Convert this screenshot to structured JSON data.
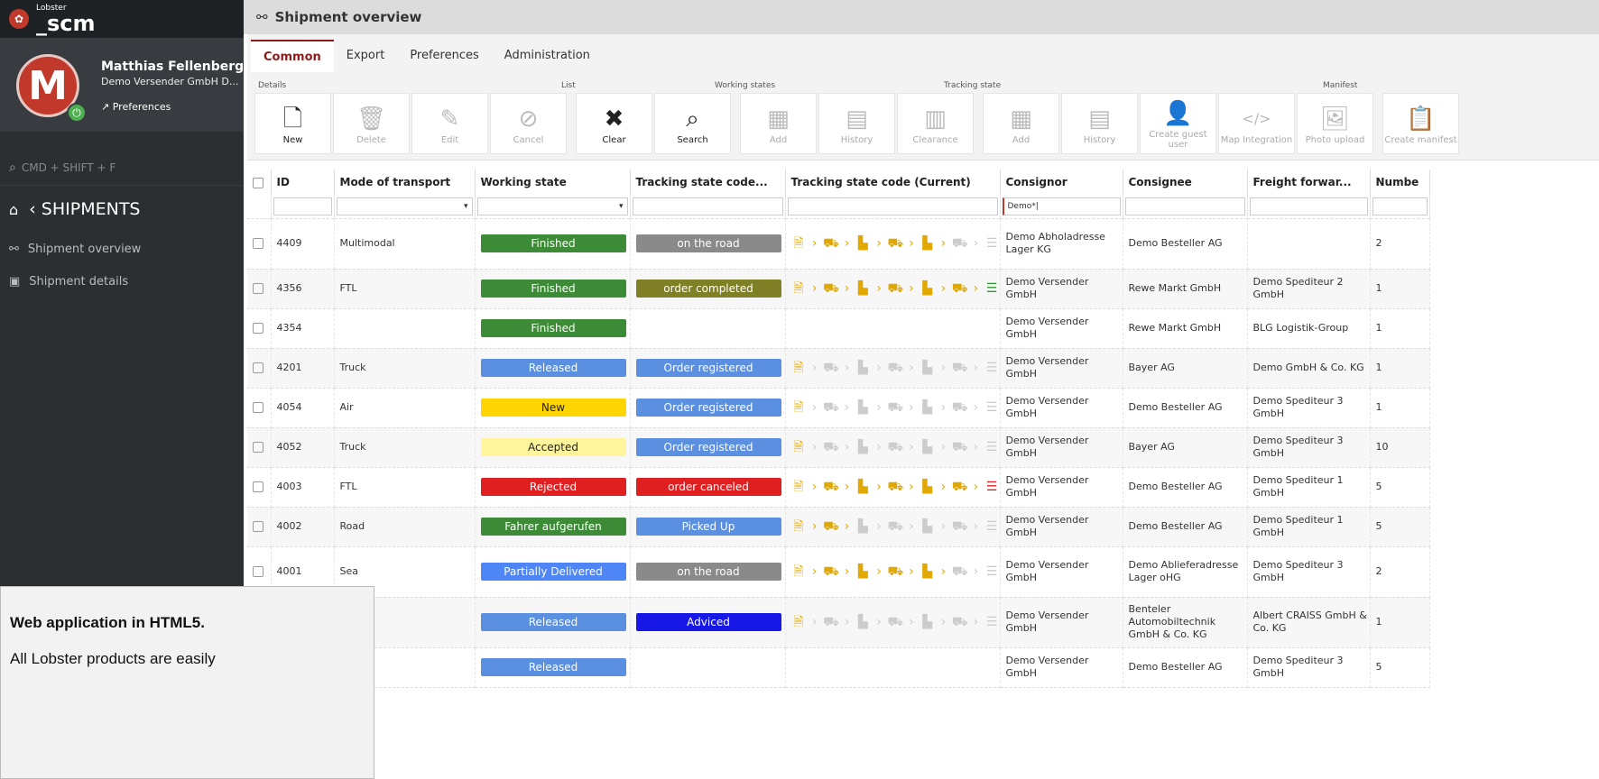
{
  "app": {
    "logo_small": "Lobster",
    "logo_big": "_scm"
  },
  "user": {
    "name": "Matthias Fellenberg",
    "company": "Demo Versender GmbH D...",
    "avatar_letter": "M",
    "preferences_label": "Preferences"
  },
  "sidebar": {
    "search_placeholder": "CMD + SHIFT + F",
    "section_title": "SHIPMENTS",
    "items": [
      {
        "label": "Shipment overview"
      },
      {
        "label": "Shipment details"
      }
    ]
  },
  "page": {
    "title": "Shipment overview"
  },
  "tabs": [
    "Common",
    "Export",
    "Preferences",
    "Administration"
  ],
  "groups": {
    "details": "Details",
    "list": "List",
    "working": "Working states",
    "tracking": "Tracking state",
    "manifest": "Manifest"
  },
  "toolbar": [
    {
      "label": "New",
      "icon": "new-document-icon",
      "glyph": "🗋",
      "disabled": false
    },
    {
      "label": "Delete",
      "icon": "trash-icon",
      "glyph": "🗑",
      "disabled": true
    },
    {
      "label": "Edit",
      "icon": "edit-icon",
      "glyph": "✎",
      "disabled": true
    },
    {
      "label": "Cancel",
      "icon": "cancel-icon",
      "glyph": "⊘",
      "disabled": true
    },
    {
      "label": "Clear",
      "icon": "clear-icon",
      "glyph": "✖",
      "disabled": false
    },
    {
      "label": "Search",
      "icon": "binoculars-icon",
      "glyph": "⌕",
      "disabled": false
    },
    {
      "label": "Add",
      "icon": "add-state-icon",
      "glyph": "▦",
      "disabled": true
    },
    {
      "label": "History",
      "icon": "history-icon",
      "glyph": "▤",
      "disabled": true
    },
    {
      "label": "Clearance",
      "icon": "clearance-icon",
      "glyph": "▥",
      "disabled": true
    },
    {
      "label": "Add",
      "icon": "add-tracking-icon",
      "glyph": "▦",
      "disabled": true
    },
    {
      "label": "History",
      "icon": "tracking-history-icon",
      "glyph": "▤",
      "disabled": true
    },
    {
      "label": "Create guest user",
      "icon": "guest-user-icon",
      "glyph": "👤",
      "disabled": true
    },
    {
      "label": "Map Integration",
      "icon": "code-icon",
      "glyph": "</>",
      "disabled": true
    },
    {
      "label": "Photo upload",
      "icon": "photo-icon",
      "glyph": "🖼",
      "disabled": true
    },
    {
      "label": "Create manifest",
      "icon": "manifest-icon",
      "glyph": "📋",
      "disabled": true
    }
  ],
  "columns": [
    "ID",
    "Mode of transport",
    "Working state",
    "Tracking state code...",
    "Tracking state code (Current)",
    "Consignor",
    "Consignee",
    "Freight forwar...",
    "Numbe"
  ],
  "filter": {
    "consignor": "Demo*|"
  },
  "colors": {
    "green": "#3d8b37",
    "gray": "#8a8a8a",
    "olive": "#7f7f26",
    "blue": "#5b8fe0",
    "yellow": "#ffd400",
    "lightyellow": "#fff59d",
    "red": "#e02020",
    "darkblue": "#1717e6",
    "partial": "#4f86f7"
  },
  "rows": [
    {
      "id": "4409",
      "mode": "Multimodal",
      "ws": "Finished",
      "wsc": "green",
      "ts": "on the road",
      "tsc": "gray",
      "prog": 4,
      "end": "off",
      "consignor": "Demo Abholadresse Lager KG",
      "consignee": "Demo Besteller AG",
      "ff": "",
      "num": "2"
    },
    {
      "id": "4356",
      "mode": "FTL",
      "ws": "Finished",
      "wsc": "green",
      "ts": "order completed",
      "tsc": "olive",
      "prog": 5,
      "end": "grn",
      "consignor": "Demo Versender GmbH",
      "consignee": "Rewe Markt GmbH",
      "ff": "Demo Spediteur 2 GmbH",
      "num": "1"
    },
    {
      "id": "4354",
      "mode": "",
      "ws": "Finished",
      "wsc": "green",
      "ts": "",
      "tsc": "",
      "prog": -1,
      "end": "",
      "consignor": "Demo Versender GmbH",
      "consignee": "Rewe Markt GmbH",
      "ff": "BLG Logistik-Group",
      "num": "1"
    },
    {
      "id": "4201",
      "mode": "Truck",
      "ws": "Released",
      "wsc": "blue",
      "ts": "Order registered",
      "tsc": "blue",
      "prog": 0,
      "end": "off",
      "consignor": "Demo Versender GmbH",
      "consignee": "Bayer AG",
      "ff": "Demo GmbH & Co. KG",
      "num": "1"
    },
    {
      "id": "4054",
      "mode": "Air",
      "ws": "New",
      "wsc": "yellow",
      "ts": "Order registered",
      "tsc": "blue",
      "prog": 0,
      "end": "off",
      "consignor": "Demo Versender GmbH",
      "consignee": "Demo Besteller AG",
      "ff": "Demo Spediteur 3 GmbH",
      "num": "1"
    },
    {
      "id": "4052",
      "mode": "Truck",
      "ws": "Accepted",
      "wsc": "lightyellow",
      "ts": "Order registered",
      "tsc": "blue",
      "prog": 0,
      "end": "off",
      "consignor": "Demo Versender GmbH",
      "consignee": "Bayer AG",
      "ff": "Demo Spediteur 3 GmbH",
      "num": "10"
    },
    {
      "id": "4003",
      "mode": "FTL",
      "ws": "Rejected",
      "wsc": "red",
      "ts": "order canceled",
      "tsc": "red",
      "prog": 5,
      "end": "red",
      "consignor": "Demo Versender GmbH",
      "consignee": "Demo Besteller AG",
      "ff": "Demo Spediteur 1 GmbH",
      "num": "5"
    },
    {
      "id": "4002",
      "mode": "Road",
      "ws": "Fahrer aufgerufen",
      "wsc": "green",
      "ts": "Picked Up",
      "tsc": "blue",
      "prog": 1,
      "end": "off",
      "consignor": "Demo Versender GmbH",
      "consignee": "Demo Besteller AG",
      "ff": "Demo Spediteur 1 GmbH",
      "num": "5"
    },
    {
      "id": "4001",
      "mode": "Sea",
      "ws": "Partially Delivered",
      "wsc": "partial",
      "ts": "on the road",
      "tsc": "gray",
      "prog": 4,
      "end": "off",
      "consignor": "Demo Versender GmbH",
      "consignee": "Demo Ablieferadresse Lager oHG",
      "ff": "Demo Spediteur 3 GmbH",
      "num": "2"
    },
    {
      "id": "",
      "mode": "",
      "ws": "Released",
      "wsc": "blue",
      "ts": "Adviced",
      "tsc": "darkblue",
      "prog": 0,
      "end": "off",
      "consignor": "Demo Versender GmbH",
      "consignee": "Benteler Automobiltechnik GmbH & Co. KG",
      "ff": "Albert CRAISS GmbH & Co. KG",
      "num": "1"
    },
    {
      "id": "",
      "mode": "",
      "ws": "Released",
      "wsc": "blue",
      "ts": "",
      "tsc": "",
      "prog": -1,
      "end": "",
      "consignor": "Demo Versender GmbH",
      "consignee": "Demo Besteller AG",
      "ff": "Demo Spediteur 3 GmbH",
      "num": "5"
    }
  ],
  "overlay": {
    "title": "Web application in HTML5.",
    "body": "All Lobster products are easily"
  }
}
